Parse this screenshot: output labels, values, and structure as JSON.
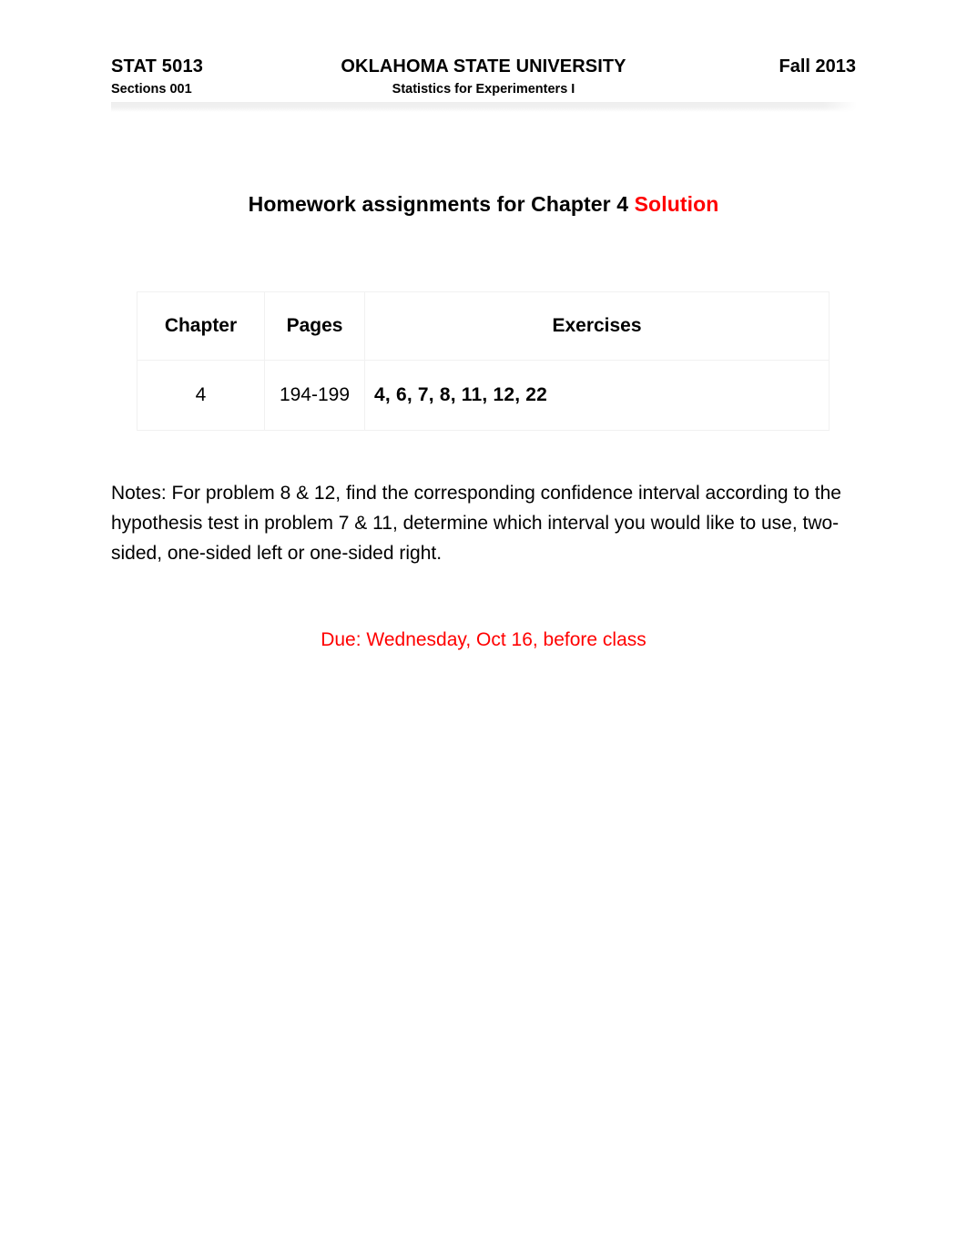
{
  "header": {
    "course_code": "STAT 5013",
    "institution": "OKLAHOMA STATE UNIVERSITY",
    "term": "Fall 2013",
    "sections": "Sections 001",
    "course_title": "Statistics for Experimenters I"
  },
  "title": {
    "main": "Homework assignments for Chapter 4 ",
    "highlight": "Solution",
    "highlight_color": "#ff0000"
  },
  "table": {
    "columns": [
      "Chapter",
      "Pages",
      "Exercises"
    ],
    "rows": [
      {
        "chapter": "4",
        "pages": "194-199",
        "exercises": "4, 6, 7, 8, 11, 12, 22"
      }
    ]
  },
  "notes": {
    "text": "Notes: For problem 8 & 12, find the corresponding confidence interval according to the hypothesis test in problem 7 & 11, determine which interval you would like to use, two-sided, one-sided left or one-sided right."
  },
  "due": {
    "text": "Due: Wednesday, Oct 16, before class",
    "color": "#ff0000"
  }
}
